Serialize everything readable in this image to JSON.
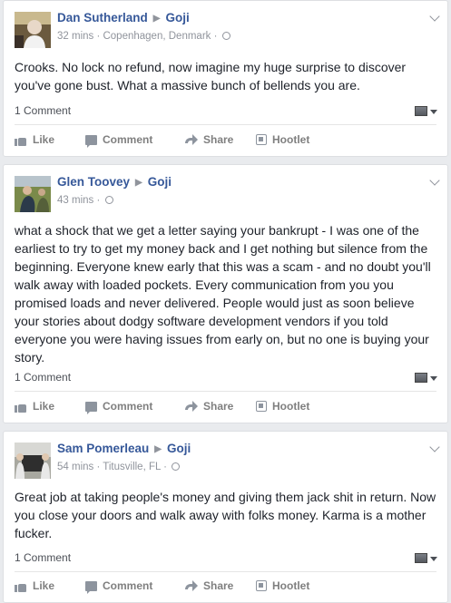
{
  "posts": [
    {
      "author": "Dan Sutherland",
      "target": "Goji",
      "meta": "32 mins · Copenhagen, Denmark ·",
      "text": "Crooks. No lock no refund, now imagine my huge surprise to discover you've gone bust. What a massive bunch of bellends you are.",
      "comments": "1 Comment"
    },
    {
      "author": "Glen Toovey",
      "target": "Goji",
      "meta": "43 mins ·",
      "text": "what a shock that we get a letter saying your bankrupt - I was one of the earliest to try to get my money back and I get nothing but silence from the beginning. Everyone knew early that this was a scam - and no doubt you'll walk away with loaded pockets. Every communication from you you promised loads and never delivered. People would just as soon believe your stories about dodgy software development vendors if you told everyone you were having issues from early on, but no one is buying your story.",
      "comments": "1 Comment"
    },
    {
      "author": "Sam Pomerleau",
      "target": "Goji",
      "meta": "54 mins · Titusville, FL ·",
      "text": "Great job at taking people's money and giving them jack shit in return. Now you close your doors and walk away with folks money. Karma is a mother fucker.",
      "comments": "1 Comment"
    }
  ],
  "actions": {
    "like": "Like",
    "comment": "Comment",
    "share": "Share",
    "hootlet": "Hootlet"
  },
  "colors": {
    "link": "#365899",
    "meta": "#90949c",
    "background": "#e9ebee"
  },
  "icons": [
    "globe-icon",
    "options-chevron-icon",
    "like-icon",
    "comment-icon",
    "share-icon",
    "hootlet-icon"
  ]
}
